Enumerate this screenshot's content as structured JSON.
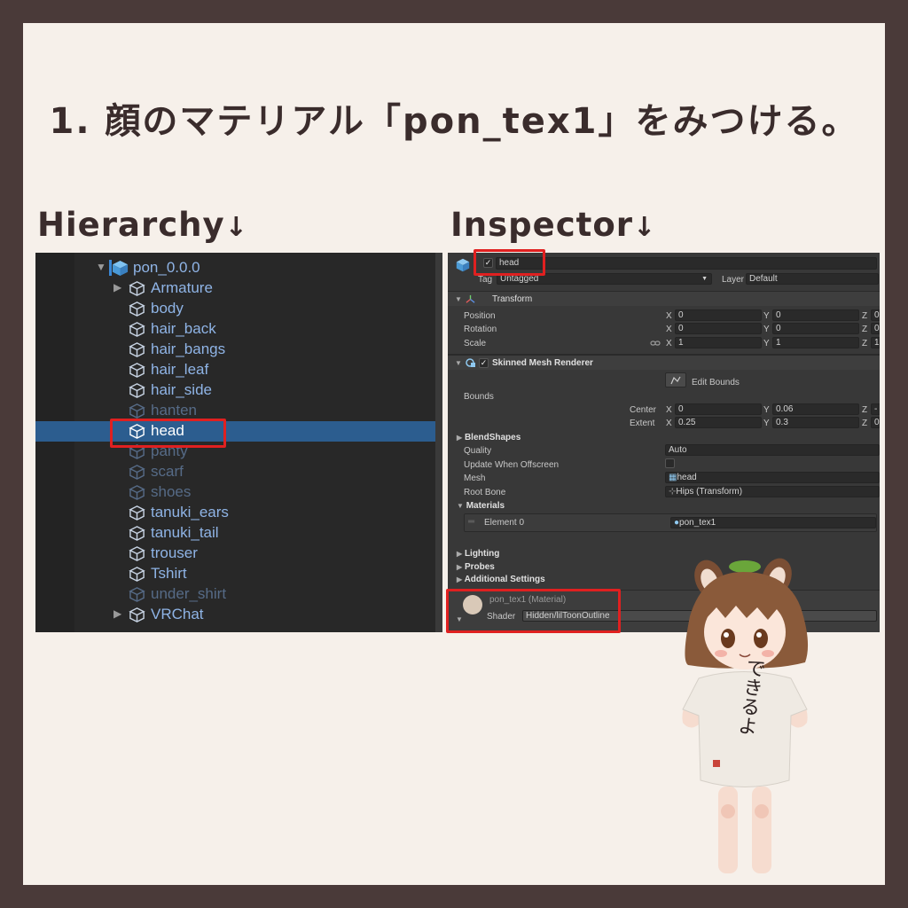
{
  "title": "1. 顔のマテリアル「pon_tex1」をみつける。",
  "labels": {
    "hierarchy": "Hierarchy",
    "inspector": "Inspector",
    "arrow": "↓"
  },
  "colors": {
    "highlight": "#e02020",
    "background": "#f6f0ea",
    "frame": "#4a3a39",
    "selection": "#2c5d8f"
  },
  "hierarchy": {
    "root": "pon_0.0.0",
    "items": [
      {
        "label": "Armature",
        "expandable": true,
        "dim": false
      },
      {
        "label": "body",
        "dim": false
      },
      {
        "label": "hair_back",
        "dim": false
      },
      {
        "label": "hair_bangs",
        "dim": false
      },
      {
        "label": "hair_leaf",
        "dim": false
      },
      {
        "label": "hair_side",
        "dim": false
      },
      {
        "label": "hanten",
        "dim": true
      },
      {
        "label": "head",
        "selected": true
      },
      {
        "label": "panty",
        "dim": true
      },
      {
        "label": "scarf",
        "dim": true
      },
      {
        "label": "shoes",
        "dim": true
      },
      {
        "label": "tanuki_ears",
        "dim": false
      },
      {
        "label": "tanuki_tail",
        "dim": false
      },
      {
        "label": "trouser",
        "dim": false
      },
      {
        "label": "Tshirt",
        "dim": false
      },
      {
        "label": "under_shirt",
        "dim": true
      },
      {
        "label": "VRChat",
        "expandable": true,
        "dim": false
      }
    ]
  },
  "inspector": {
    "object_name": "head",
    "tag_label": "Tag",
    "tag_value": "Untagged",
    "layer_label": "Layer",
    "layer_value": "Default",
    "transform": {
      "title": "Transform",
      "position_label": "Position",
      "rotation_label": "Rotation",
      "scale_label": "Scale",
      "position": {
        "x": "0",
        "y": "0",
        "z": "0"
      },
      "rotation": {
        "x": "0",
        "y": "0",
        "z": "0"
      },
      "scale": {
        "x": "1",
        "y": "1",
        "z": "1"
      }
    },
    "axis": {
      "x": "X",
      "y": "Y",
      "z": "Z"
    },
    "smr": {
      "title": "Skinned Mesh Renderer",
      "edit_bounds": "Edit Bounds",
      "bounds_label": "Bounds",
      "center_label": "Center",
      "extent_label": "Extent",
      "center": {
        "x": "0",
        "y": "0.06",
        "z": "-"
      },
      "extent": {
        "x": "0.25",
        "y": "0.3",
        "z": "0"
      },
      "blendshapes": "BlendShapes",
      "quality_label": "Quality",
      "quality_value": "Auto",
      "update_offscreen_label": "Update When Offscreen",
      "mesh_label": "Mesh",
      "mesh_value": "head",
      "root_bone_label": "Root Bone",
      "root_bone_value": "Hips (Transform)",
      "materials_label": "Materials",
      "element0_label": "Element 0",
      "element0_value": "pon_tex1",
      "lighting": "Lighting",
      "probes": "Probes",
      "additional_settings": "Additional Settings"
    },
    "material": {
      "name": "pon_tex1 (Material)",
      "shader_label": "Shader",
      "shader_value": "Hidden/lilToonOutline"
    }
  },
  "shirt_text": "できるよ"
}
